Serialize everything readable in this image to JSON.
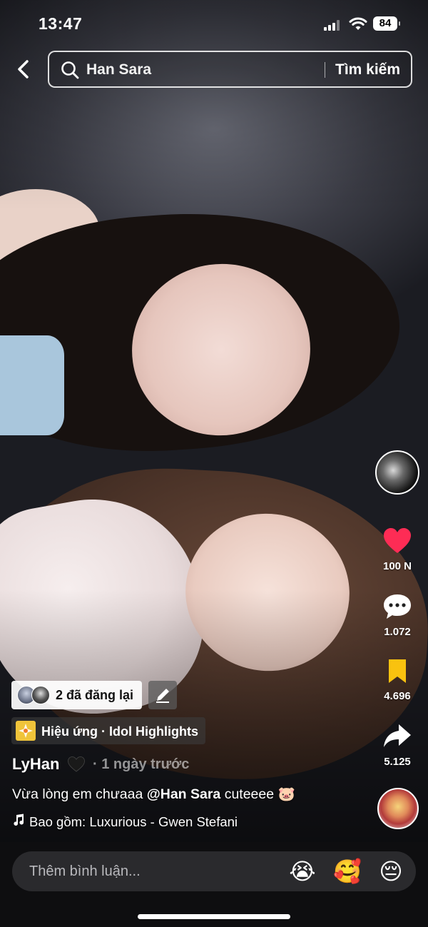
{
  "status_bar": {
    "time": "13:47",
    "battery": "84"
  },
  "search": {
    "query": "Han Sara",
    "submit_label": "Tìm kiếm"
  },
  "rail": {
    "likes": "100 N",
    "comments": "1.072",
    "saves": "4.696",
    "shares": "5.125"
  },
  "repost": {
    "label": "2 đã đăng lại"
  },
  "effect": {
    "label": "Hiệu ứng · Idol Highlights"
  },
  "post": {
    "author": "LyHan",
    "time_ago": "· 1 ngày trước",
    "caption_before": "Vừa lòng em chưaaa ",
    "caption_mention": "@Han Sara",
    "caption_after": " cuteeee 🐷",
    "music": "Bao gồm: Luxurious - Gwen Stefani"
  },
  "comment_bar": {
    "placeholder": "Thêm bình luận...",
    "emojis": [
      "😭",
      "🥰",
      "😔"
    ]
  },
  "colors": {
    "like_red": "#fe2c55",
    "save_yellow": "#f9c20f",
    "accent_white": "#ffffff"
  }
}
